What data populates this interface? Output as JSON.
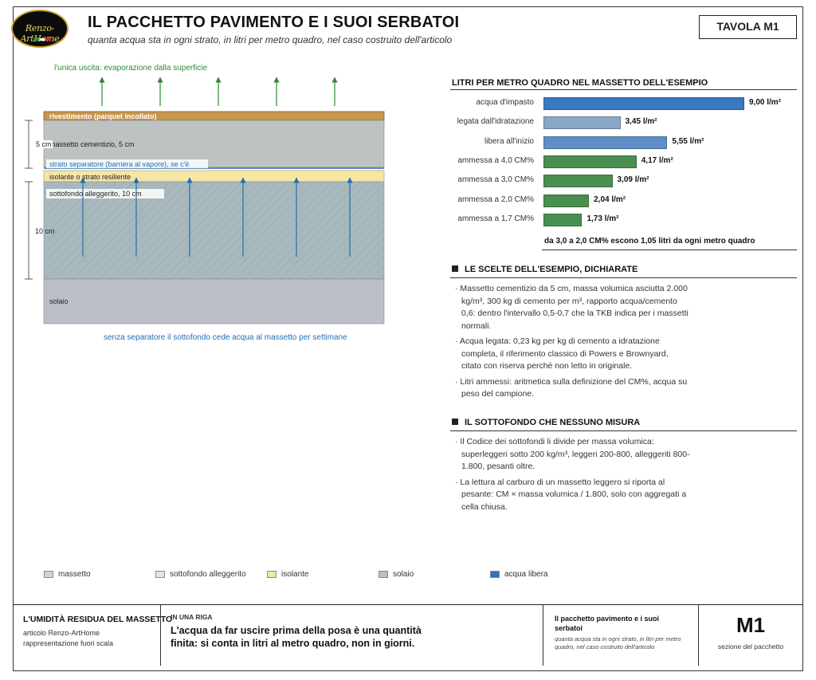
{
  "header": {
    "logo_text": "Renzo-ArtHome",
    "title": "IL PACCHETTO PAVIMENTO E I SUOI SERBATOI",
    "subtitle": "quanta acqua sta in ogni strato, in litri per metro quadro, nel caso costruito dell'articolo",
    "tavola": "TAVOLA M1"
  },
  "diagram": {
    "top_note": "l'unica uscita: evaporazione dalla superficie",
    "layers": {
      "rivestimento": "rivestimento (parquet incollato)",
      "massetto": "massetto cementizio, 5 cm",
      "separatore": "strato separatore (barriera al vapore), se c'è",
      "isolante": "isolante o strato resiliente",
      "sottofondo": "sottofondo alleggerito, 10 cm",
      "solaio": "solaio"
    },
    "dim_5cm": "5 cm",
    "dim_10cm": "10 cm",
    "bottom_note": "senza separatore il sottofondo cede acqua al massetto per settimane",
    "colors": {
      "rivestimento": "#c9964f",
      "massetto": "#bcc3c2",
      "isolante": "#f3e6a6",
      "sottofondo": "#a6b8bd",
      "solaio": "#bcbfc7",
      "arrow_green": "#2f8a2f",
      "arrow_blue": "#1f6fb5"
    }
  },
  "chart_section": {
    "title": "LITRI PER METRO QUADRO NEL MASSETTO DELL'ESEMPIO",
    "note": "da 3,0 a 2,0 CM% escono 1,05 litri da ogni metro quadro"
  },
  "chart_data": {
    "type": "bar",
    "orientation": "horizontal",
    "categories": [
      "acqua d'impasto",
      "legata dall'idratazione",
      "libera all'inizio",
      "ammessa a 4,0 CM%",
      "ammessa a 3,0 CM%",
      "ammessa a 2,0 CM%",
      "ammessa a 1,7 CM%"
    ],
    "values": [
      9.0,
      3.45,
      5.55,
      4.17,
      3.09,
      2.04,
      1.73
    ],
    "value_labels": [
      "9,00 l/m²",
      "3,45 l/m²",
      "5,55 l/m²",
      "4,17 l/m²",
      "3,09 l/m²",
      "2,04 l/m²",
      "1,73 l/m²"
    ],
    "colors": [
      "#3a78bf",
      "#8aa7c9",
      "#5f8fc6",
      "#4a8f4f",
      "#4a8f4f",
      "#4a8f4f",
      "#4a8f4f"
    ],
    "xlim": [
      0,
      9
    ],
    "grid": false
  },
  "scelte": {
    "title": "LE SCELTE DELL'ESEMPIO, DICHIARATE",
    "items": [
      "· Massetto cementizio da 5 cm, massa volumica asciutta 2.000 kg/m³, 300 kg di cemento per m³, rapporto acqua/cemento 0,6: dentro l'intervallo 0,5-0,7 che la TKB indica per i massetti normali.",
      "· Acqua legata: 0,23 kg per kg di cemento a idratazione completa, il riferimento classico di Powers e Brownyard, citato con riserva perché non letto in originale.",
      "· Litri ammessi: aritmetica sulla definizione del CM%, acqua su peso del campione."
    ]
  },
  "sottofondo": {
    "title": "IL SOTTOFONDO CHE NESSUNO MISURA",
    "items": [
      "· Il Codice dei sottofondi li divide per massa volumica: superleggeri sotto 200 kg/m³, leggeri 200-800, alleggeriti 800-1.800, pesanti oltre.",
      "· La lettura al carburo di un massetto leggero si riporta al pesante: CM × massa volumica / 1.800, solo con aggregati a cella chiusa."
    ]
  },
  "legend": [
    {
      "label": "massetto",
      "color": "#d6d3cb"
    },
    {
      "label": "sottofondo alleggerito",
      "color": "#ebe6d3"
    },
    {
      "label": "isolante",
      "color": "#f3e6a6"
    },
    {
      "label": "solaio",
      "color": "#bcbfc7"
    },
    {
      "label": "acqua libera",
      "color": "#2f72b8"
    }
  ],
  "footer": {
    "left_title": "L'UMIDITÀ RESIDUA DEL MASSETTO",
    "left_sub1": "articolo Renzo-ArtHome",
    "left_sub2": "rappresentazione fuori scala",
    "mid_kicker": "IN UNA RIGA",
    "mid_text": "L'acqua da far uscire prima della posa è una quantità finita: si conta in litri al metro quadro, non in giorni.",
    "right_title": "Il pacchetto pavimento e i suoi serbatoi",
    "right_sub": "quanta acqua sta in ogni strato, in litri per metro quadro, nel caso costruito dell'articolo",
    "code": "M1",
    "code_sub": "sezione del pacchetto"
  }
}
